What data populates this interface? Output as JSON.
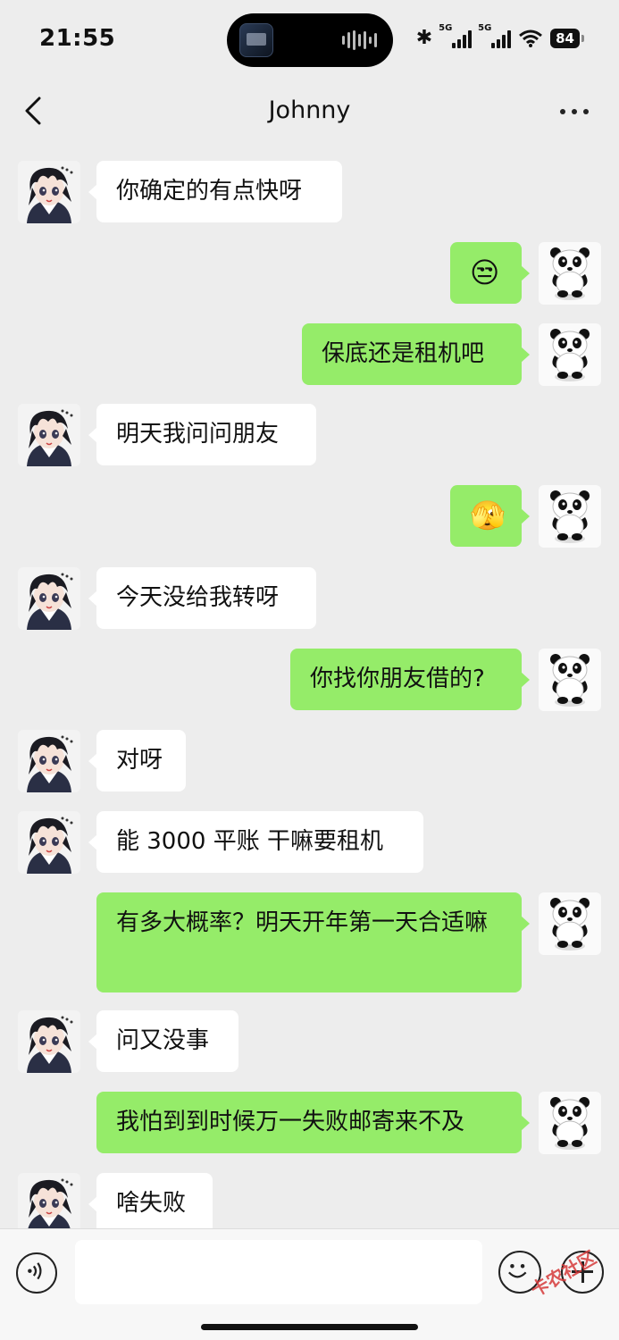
{
  "status_bar": {
    "time": "21:55",
    "network_1": "5G",
    "network_2": "5G",
    "battery": "84"
  },
  "chat": {
    "title": "Johnny"
  },
  "colors": {
    "background": "#ededed",
    "incoming_bubble": "#ffffff",
    "outgoing_bubble": "#95ec69"
  },
  "messages": [
    {
      "sender": "contact",
      "text": "你确定的有点快呀"
    },
    {
      "sender": "me",
      "text": "😒",
      "icon": "unamused-emoji"
    },
    {
      "sender": "me",
      "text": "保底还是租机吧"
    },
    {
      "sender": "contact",
      "text": "明天我问问朋友"
    },
    {
      "sender": "me",
      "text": "🫣",
      "icon": "confused-question-emoji"
    },
    {
      "sender": "contact",
      "text": "今天没给我转呀"
    },
    {
      "sender": "me",
      "text": "你找你朋友借的?"
    },
    {
      "sender": "contact",
      "text": "对呀"
    },
    {
      "sender": "contact",
      "text": "能 3000 平账 干嘛要租机"
    },
    {
      "sender": "me",
      "text": "有多大概率？明天开年第一天合适嘛"
    },
    {
      "sender": "contact",
      "text": "问又没事"
    },
    {
      "sender": "me",
      "text": "我怕到到时候万一失败邮寄来不及"
    },
    {
      "sender": "contact",
      "text": "啥失败"
    }
  ],
  "input": {
    "value": "",
    "placeholder": ""
  },
  "watermark": "卡农社区"
}
